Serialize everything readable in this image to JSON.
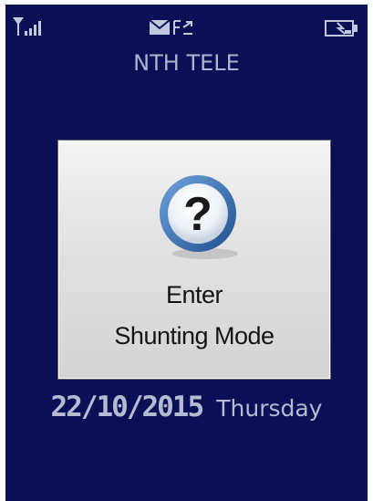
{
  "status_bar": {
    "signal_icon": "signal-strength-icon",
    "message_icon": "message-icon",
    "call_forward_icon": "call-forward-icon",
    "battery_icon": "battery-icon"
  },
  "operator_name": "NTH TELE",
  "dialog": {
    "icon": "question-mark-icon",
    "line1": "Enter",
    "line2": "Shunting Mode"
  },
  "footer": {
    "date": "22/10/2015",
    "weekday": "Thursday"
  },
  "colors": {
    "screen_background": "#0b0f55",
    "status_text": "#aeb4cf",
    "icon_blue": "#2a5a99"
  }
}
